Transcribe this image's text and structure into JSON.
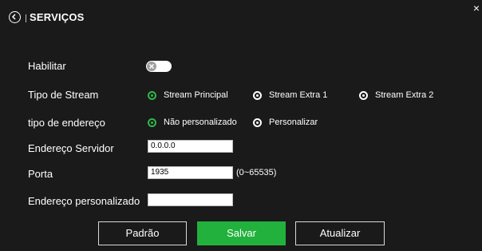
{
  "header": {
    "title": "SERVIÇOS",
    "back_icon": "chevron-left-circle-icon",
    "close_icon": "close-icon",
    "close_glyph": "×"
  },
  "form": {
    "enable": {
      "label": "Habilitar",
      "on": false
    },
    "stream_type": {
      "label": "Tipo de Stream",
      "options": [
        "Stream Principal",
        "Stream Extra 1",
        "Stream Extra 2"
      ],
      "selected": "Stream Principal"
    },
    "address_type": {
      "label": "tipo de endereço",
      "options": [
        "Não personalizado",
        "Personalizar"
      ],
      "selected": "Não personalizado"
    },
    "server_address": {
      "label": "Endereço Servidor",
      "value": "0.0.0.0"
    },
    "port": {
      "label": "Porta",
      "value": "1935",
      "hint": "(0~65535)"
    },
    "custom_address": {
      "label": "Endereço personalizado",
      "value": ""
    }
  },
  "buttons": {
    "default": "Padrão",
    "save": "Salvar",
    "refresh": "Atualizar"
  },
  "colors": {
    "background": "#1a1a1a",
    "accent": "#22b13d",
    "text": "#ffffff"
  }
}
